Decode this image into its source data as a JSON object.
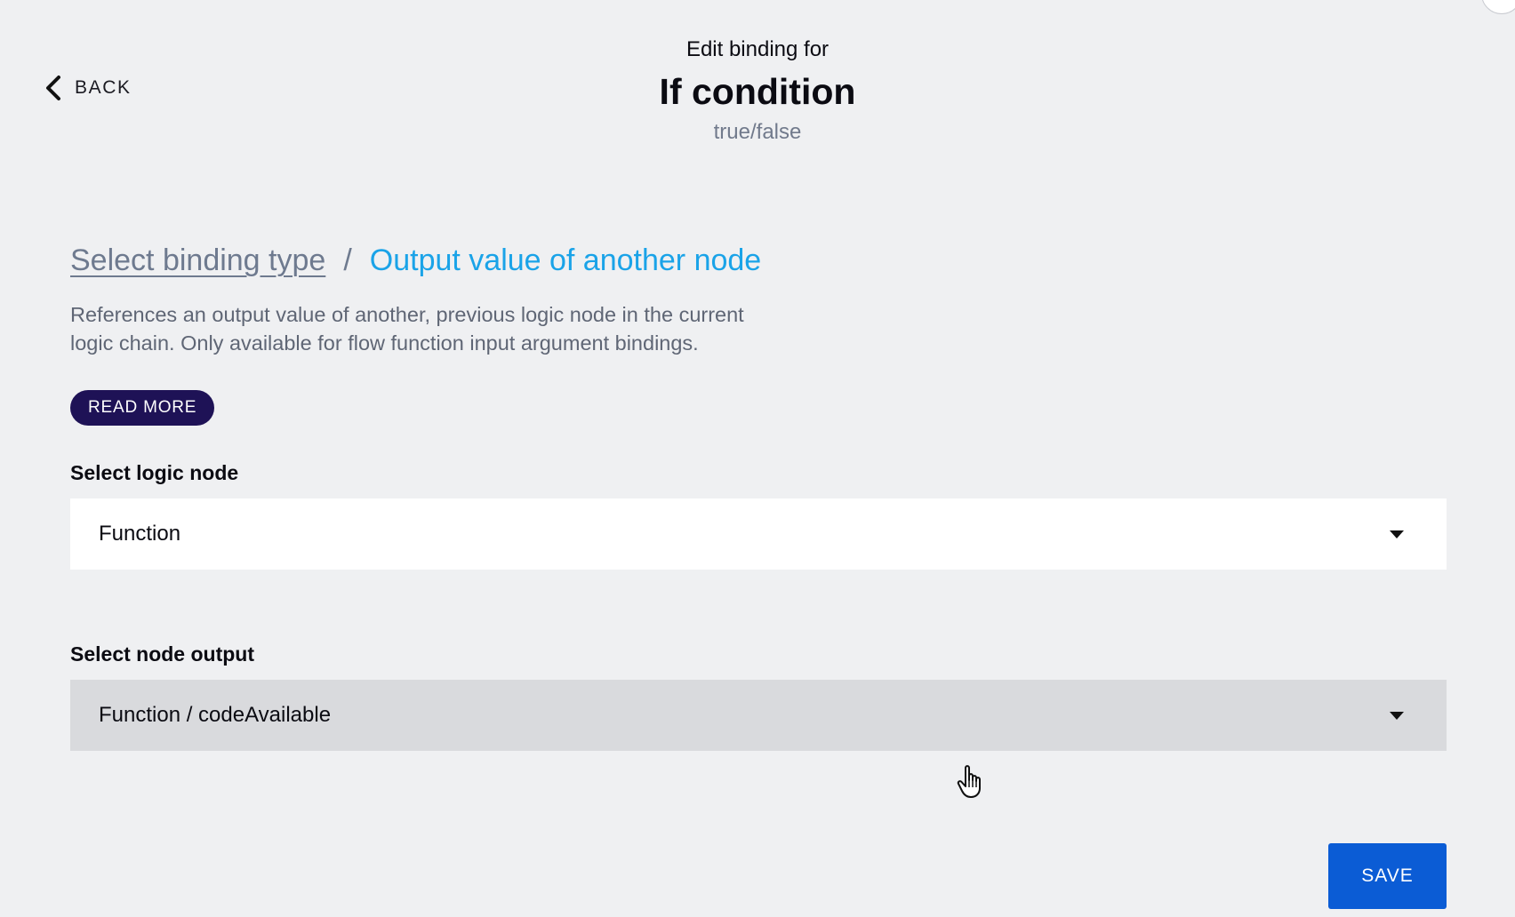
{
  "header": {
    "back_label": "BACK",
    "eyebrow": "Edit binding for",
    "title": "If condition",
    "subtitle": "true/false"
  },
  "breadcrumb": {
    "parent": "Select binding type",
    "separator": "/",
    "current": "Output value of another node"
  },
  "description": "References an output value of another, previous logic node in the current logic chain. Only available for flow function input argument bindings.",
  "read_more_label": "READ MORE",
  "logic_node": {
    "label": "Select logic node",
    "value": "Function"
  },
  "node_output": {
    "label": "Select node output",
    "value": "Function / codeAvailable"
  },
  "save_label": "SAVE",
  "colors": {
    "background": "#eff0f2",
    "accent_link": "#1aa3e8",
    "read_more_bg": "#1e1256",
    "save_bg": "#0b5cd5"
  },
  "icons": {
    "back": "chevron-left-icon",
    "dropdown": "caret-down-icon",
    "cursor": "hand-pointer-icon"
  }
}
